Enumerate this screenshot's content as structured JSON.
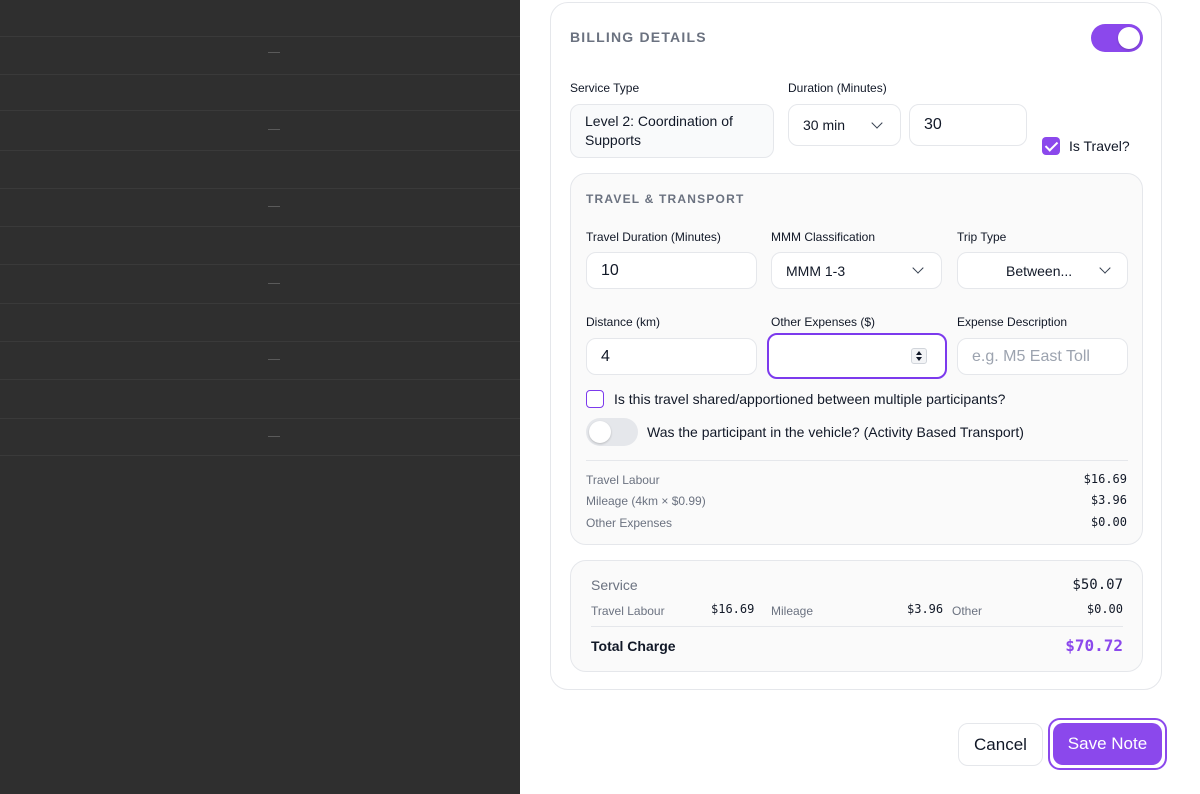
{
  "billing": {
    "title": "BILLING DETAILS",
    "enabled": true,
    "service_type_label": "Service Type",
    "service_type_value": "Level 2: Coordination of Supports",
    "duration_label": "Duration (Minutes)",
    "duration_select": "30 min",
    "duration_value": "30",
    "is_travel_label": "Is Travel?",
    "is_travel_checked": true
  },
  "travel": {
    "title": "TRAVEL & TRANSPORT",
    "travel_duration_label": "Travel Duration (Minutes)",
    "travel_duration_value": "10",
    "mmm_label": "MMM Classification",
    "mmm_value": "MMM 1-3",
    "trip_type_label": "Trip Type",
    "trip_type_value": "Between...",
    "distance_label": "Distance (km)",
    "distance_value": "4",
    "other_expenses_label": "Other Expenses ($)",
    "other_expenses_value": "",
    "expense_desc_label": "Expense Description",
    "expense_desc_placeholder": "e.g. M5 East Toll",
    "shared_label": "Is this travel shared/apportioned between multiple participants?",
    "shared_checked": false,
    "abt_label": "Was the participant in the vehicle? (Activity Based Transport)",
    "abt_on": false,
    "breakdown": [
      {
        "label": "Travel Labour",
        "value": "$16.69"
      },
      {
        "label": "Mileage (4km × $0.99)",
        "value": "$3.96"
      },
      {
        "label": "Other Expenses",
        "value": "$0.00"
      }
    ]
  },
  "summary": {
    "service_label": "Service",
    "service_value": "$50.07",
    "travel_labour_label": "Travel Labour",
    "travel_labour_value": "$16.69",
    "mileage_label": "Mileage",
    "mileage_value": "$3.96",
    "other_label": "Other",
    "other_value": "$0.00",
    "total_label": "Total Charge",
    "total_value": "$70.72",
    "accent": "#8b48ec"
  },
  "actions": {
    "cancel": "Cancel",
    "save": "Save Note"
  }
}
